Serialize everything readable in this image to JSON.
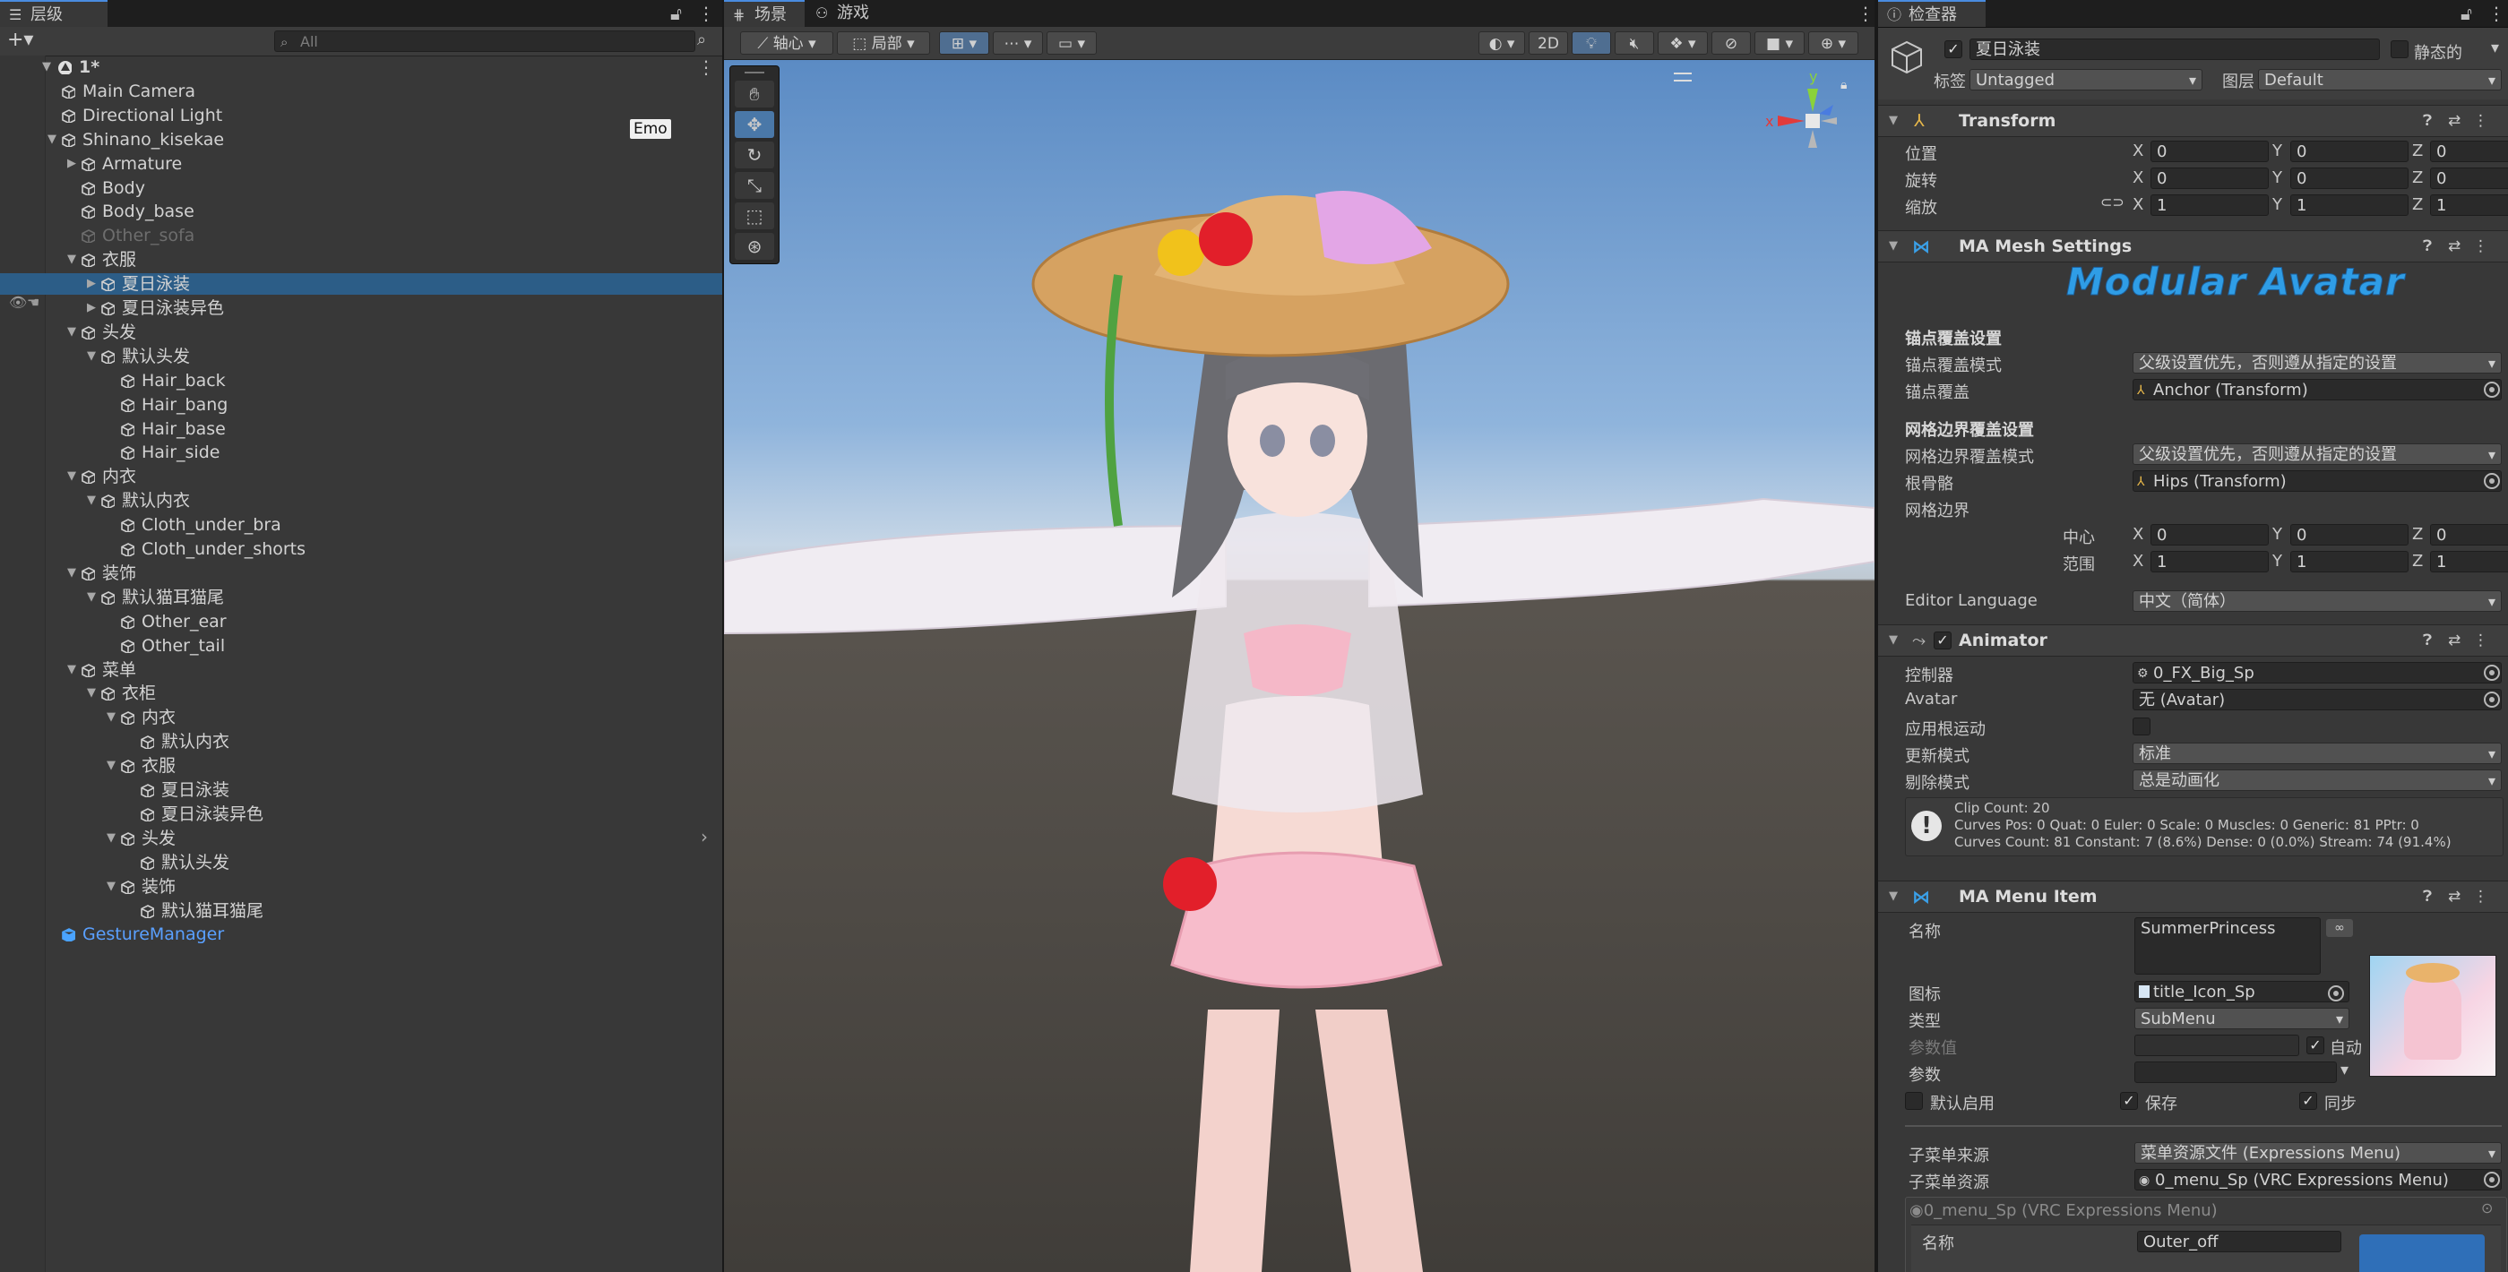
{
  "hierarchy": {
    "tab": "层级",
    "search_placeholder": "All",
    "add_label": "+▾",
    "emo_badge": "Emo",
    "rows": [
      {
        "label": "1*",
        "depth": 0,
        "arrow": "▼",
        "icon": "unity",
        "style": "normal"
      },
      {
        "label": "Main Camera",
        "depth": 1,
        "arrow": "",
        "icon": "cube",
        "style": "normal"
      },
      {
        "label": "Directional Light",
        "depth": 1,
        "arrow": "",
        "icon": "cube",
        "style": "normal"
      },
      {
        "label": "Shinano_kisekae",
        "depth": 1,
        "arrow": "▼",
        "icon": "cube",
        "style": "normal"
      },
      {
        "label": "Armature",
        "depth": 2,
        "arrow": "▶",
        "icon": "cube",
        "style": "normal"
      },
      {
        "label": "Body",
        "depth": 2,
        "arrow": "",
        "icon": "cube",
        "style": "normal"
      },
      {
        "label": "Body_base",
        "depth": 2,
        "arrow": "",
        "icon": "cube",
        "style": "normal"
      },
      {
        "label": "Other_sofa",
        "depth": 2,
        "arrow": "",
        "icon": "cube",
        "style": "dim"
      },
      {
        "label": "衣服",
        "depth": 2,
        "arrow": "▼",
        "icon": "cube",
        "style": "normal"
      },
      {
        "label": "夏日泳装",
        "depth": 3,
        "arrow": "▶",
        "icon": "cube",
        "style": "selected"
      },
      {
        "label": "夏日泳装异色",
        "depth": 3,
        "arrow": "▶",
        "icon": "cube",
        "style": "normal"
      },
      {
        "label": "头发",
        "depth": 2,
        "arrow": "▼",
        "icon": "cube",
        "style": "normal"
      },
      {
        "label": "默认头发",
        "depth": 3,
        "arrow": "▼",
        "icon": "cube",
        "style": "normal"
      },
      {
        "label": "Hair_back",
        "depth": 4,
        "arrow": "",
        "icon": "cube",
        "style": "normal"
      },
      {
        "label": "Hair_bang",
        "depth": 4,
        "arrow": "",
        "icon": "cube",
        "style": "normal"
      },
      {
        "label": "Hair_base",
        "depth": 4,
        "arrow": "",
        "icon": "cube",
        "style": "normal"
      },
      {
        "label": "Hair_side",
        "depth": 4,
        "arrow": "",
        "icon": "cube",
        "style": "normal"
      },
      {
        "label": "内衣",
        "depth": 2,
        "arrow": "▼",
        "icon": "cube",
        "style": "normal"
      },
      {
        "label": "默认内衣",
        "depth": 3,
        "arrow": "▼",
        "icon": "cube",
        "style": "normal"
      },
      {
        "label": "Cloth_under_bra",
        "depth": 4,
        "arrow": "",
        "icon": "cube",
        "style": "normal"
      },
      {
        "label": "Cloth_under_shorts",
        "depth": 4,
        "arrow": "",
        "icon": "cube",
        "style": "normal"
      },
      {
        "label": "装饰",
        "depth": 2,
        "arrow": "▼",
        "icon": "cube",
        "style": "normal"
      },
      {
        "label": "默认猫耳猫尾",
        "depth": 3,
        "arrow": "▼",
        "icon": "cube",
        "style": "normal"
      },
      {
        "label": "Other_ear",
        "depth": 4,
        "arrow": "",
        "icon": "cube",
        "style": "normal"
      },
      {
        "label": "Other_tail",
        "depth": 4,
        "arrow": "",
        "icon": "cube",
        "style": "normal"
      },
      {
        "label": "菜单",
        "depth": 2,
        "arrow": "▼",
        "icon": "cube",
        "style": "normal"
      },
      {
        "label": "衣柜",
        "depth": 3,
        "arrow": "▼",
        "icon": "cube",
        "style": "normal"
      },
      {
        "label": "内衣",
        "depth": 4,
        "arrow": "▼",
        "icon": "cube",
        "style": "normal"
      },
      {
        "label": "默认内衣",
        "depth": 5,
        "arrow": "",
        "icon": "cube",
        "style": "normal"
      },
      {
        "label": "衣服",
        "depth": 4,
        "arrow": "▼",
        "icon": "cube",
        "style": "normal"
      },
      {
        "label": "夏日泳装",
        "depth": 5,
        "arrow": "",
        "icon": "cube",
        "style": "normal"
      },
      {
        "label": "夏日泳装异色",
        "depth": 5,
        "arrow": "",
        "icon": "cube",
        "style": "normal"
      },
      {
        "label": "头发",
        "depth": 4,
        "arrow": "▼",
        "icon": "cube",
        "style": "normal"
      },
      {
        "label": "默认头发",
        "depth": 5,
        "arrow": "",
        "icon": "cube",
        "style": "normal"
      },
      {
        "label": "装饰",
        "depth": 4,
        "arrow": "▼",
        "icon": "cube",
        "style": "normal"
      },
      {
        "label": "默认猫耳猫尾",
        "depth": 5,
        "arrow": "",
        "icon": "cube",
        "style": "normal"
      },
      {
        "label": "GestureManager",
        "depth": 1,
        "arrow": "",
        "icon": "cube-blue",
        "style": "blue"
      }
    ]
  },
  "scene": {
    "tab_scene": "场景",
    "tab_game": "游戏",
    "pivot_label": "轴心",
    "local_label": "局部",
    "mode_2d": "2D",
    "gizmo_y": "y",
    "gizmo_x": "x"
  },
  "inspector": {
    "tab": "检查器",
    "object_name": "夏日泳装",
    "static_label": "静态的",
    "tag_label": "标签",
    "tag_value": "Untagged",
    "layer_label": "图层",
    "layer_value": "Default",
    "transform": {
      "title": "Transform",
      "position_label": "位置",
      "rotation_label": "旋转",
      "scale_label": "缩放",
      "position": [
        "0",
        "0",
        "0"
      ],
      "rotation": [
        "0",
        "0",
        "0"
      ],
      "scale": [
        "1",
        "1",
        "1"
      ]
    },
    "axis": [
      "X",
      "Y",
      "Z"
    ],
    "mesh": {
      "title": "MA Mesh Settings",
      "logo_text": "Modular Avatar",
      "anchor_section": "锚点覆盖设置",
      "anchor_mode_label": "锚点覆盖模式",
      "anchor_mode_value": "父级设置优先，否则遵从指定的设置",
      "anchor_label": "锚点覆盖",
      "anchor_value": "Anchor (Transform)",
      "bounds_section": "网格边界覆盖设置",
      "bounds_mode_label": "网格边界覆盖模式",
      "bounds_mode_value": "父级设置优先，否则遵从指定的设置",
      "root_bone_label": "根骨骼",
      "root_bone_value": "Hips (Transform)",
      "bounds_label": "网格边界",
      "center_label": "中心",
      "extent_label": "范围",
      "center": [
        "0",
        "0",
        "0"
      ],
      "extent": [
        "1",
        "1",
        "1"
      ],
      "editor_language_label": "Editor Language",
      "editor_language_value": "中文（简体）"
    },
    "animator": {
      "title": "Animator",
      "controller_label": "控制器",
      "controller_value": "0_FX_Big_Sp",
      "avatar_label": "Avatar",
      "avatar_value": "无 (Avatar)",
      "root_motion_label": "应用根运动",
      "update_mode_label": "更新模式",
      "update_mode_value": "标准",
      "culling_label": "剔除模式",
      "culling_value": "总是动画化",
      "info_line1": "Clip Count: 20",
      "info_line2": "Curves Pos: 0 Quat: 0 Euler: 0 Scale: 0 Muscles: 0 Generic: 81 PPtr: 0",
      "info_line3": "Curves Count: 81 Constant: 7 (8.6%) Dense: 0 (0.0%) Stream: 74 (91.4%)"
    },
    "menu_item": {
      "title": "MA Menu Item",
      "name_label": "名称",
      "name_value": "SummerPrincess",
      "icon_label": "图标",
      "icon_value": "title_Icon_Sp",
      "type_label": "类型",
      "type_value": "SubMenu",
      "param_value_label": "参数值",
      "auto_label": "自动",
      "param_label": "参数",
      "default_on_label": "默认启用",
      "saved_label": "保存",
      "synced_label": "同步",
      "submenu_source_label": "子菜单来源",
      "submenu_source_value": "菜单资源文件 (Expressions Menu)",
      "submenu_asset_label": "子菜单资源",
      "submenu_asset_value": "0_menu_Sp (VRC Expressions Menu)",
      "embedded_header": "0_menu_Sp (VRC Expressions Menu)",
      "embedded_name_label": "名称",
      "embedded_name_value": "Outer_off"
    }
  },
  "colors": {
    "selection": "#2c5d87",
    "accent": "#4a8ce0",
    "ma_blue": "#3aa0e8",
    "gizmo_red": "#e23b3b",
    "gizmo_green": "#8ad23a",
    "gizmo_blue": "#4a7ce0"
  }
}
